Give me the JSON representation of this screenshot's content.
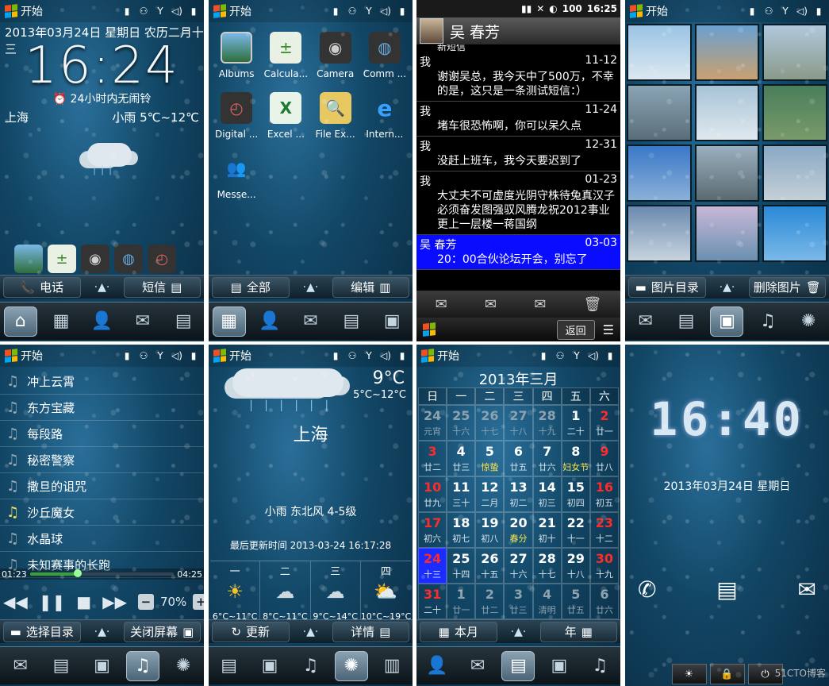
{
  "status": {
    "start_label": "开始"
  },
  "home": {
    "date": "2013年03月24日 星期日 农历二月十三",
    "time": "16:24",
    "alarm": "24小时内无闹铃",
    "city": "上海",
    "weather": "小雨 5℃~12℃",
    "soft_left": "电话",
    "soft_right": "短信"
  },
  "apps": {
    "items": [
      "Albums",
      "Calcula...",
      "Camera",
      "Comm ...",
      "Digital ...",
      "Excel ...",
      "File Ex...",
      "Intern...",
      "Messe..."
    ],
    "soft_left": "全部",
    "soft_right": "编辑"
  },
  "sms": {
    "contact": "吴 春芳",
    "time": "16:25",
    "battery": "100",
    "top_fragment": "新短信",
    "messages": [
      {
        "from": "我",
        "date": "11-12",
        "body": "谢谢吴总，我今天中了500万，不幸的是，这只是一条测试短信：）"
      },
      {
        "from": "我",
        "date": "11-24",
        "body": "堵车很恐怖啊，你可以呆久点"
      },
      {
        "from": "我",
        "date": "12-31",
        "body": "没赶上班车，我今天要迟到了"
      },
      {
        "from": "我",
        "date": "01-23",
        "body": "大丈夫不可虚度光阴守株待兔真汉子必须奋发图强驭风腾龙祝2012事业更上一层楼一蒋国纲"
      },
      {
        "from": "吴 春芳",
        "date": "03-03",
        "body": "20：00合伙论坛开会，别忘了"
      }
    ],
    "back": "返回"
  },
  "gallery": {
    "soft_left": "图片目录",
    "soft_right": "删除图片"
  },
  "music": {
    "songs": [
      "冲上云霄",
      "东方宝藏",
      "每段路",
      "秘密警察",
      "撒旦的诅咒",
      "沙丘魔女",
      "水晶球",
      "未知赛事的长跑"
    ],
    "current_index": 5,
    "elapsed": "01:23",
    "total": "04:25",
    "progress": 0.33,
    "volume": "70%",
    "soft_left": "选择目录",
    "soft_right": "关闭屏幕"
  },
  "weather": {
    "temp": "9°C",
    "range": "5°C~12°C",
    "city": "上海",
    "desc": "小雨 东北风 4-5级",
    "updated": "最后更新时间 2013-03-24 16:17:28",
    "forecast": [
      {
        "day": "一",
        "icon": "sun",
        "range": "6°C~11°C"
      },
      {
        "day": "二",
        "icon": "cloud-rain",
        "range": "8°C~11°C"
      },
      {
        "day": "三",
        "icon": "cloud-rain",
        "range": "9°C~14°C"
      },
      {
        "day": "四",
        "icon": "sun-cloud",
        "range": "10°C~19°C"
      }
    ],
    "soft_left": "更新",
    "soft_right": "详情"
  },
  "calendar": {
    "title": "2013年三月",
    "weekdays": [
      "日",
      "一",
      "二",
      "三",
      "四",
      "五",
      "六"
    ],
    "cells": [
      {
        "d": "24",
        "l": "元宵",
        "s": "dim"
      },
      {
        "d": "25",
        "l": "十六",
        "s": "dim"
      },
      {
        "d": "26",
        "l": "十七",
        "s": "dim"
      },
      {
        "d": "27",
        "l": "十八",
        "s": "dim"
      },
      {
        "d": "28",
        "l": "十九",
        "s": "dim"
      },
      {
        "d": "1",
        "l": "二十",
        "s": ""
      },
      {
        "d": "2",
        "l": "廿一",
        "s": "red"
      },
      {
        "d": "3",
        "l": "廿二",
        "s": "red"
      },
      {
        "d": "4",
        "l": "廿三",
        "s": ""
      },
      {
        "d": "5",
        "l": "惊蛰",
        "s": "fest"
      },
      {
        "d": "6",
        "l": "廿五",
        "s": ""
      },
      {
        "d": "7",
        "l": "廿六",
        "s": ""
      },
      {
        "d": "8",
        "l": "妇女节",
        "s": "fest"
      },
      {
        "d": "9",
        "l": "廿八",
        "s": "red"
      },
      {
        "d": "10",
        "l": "廿九",
        "s": "red"
      },
      {
        "d": "11",
        "l": "三十",
        "s": ""
      },
      {
        "d": "12",
        "l": "二月",
        "s": ""
      },
      {
        "d": "13",
        "l": "初二",
        "s": ""
      },
      {
        "d": "14",
        "l": "初三",
        "s": ""
      },
      {
        "d": "15",
        "l": "初四",
        "s": ""
      },
      {
        "d": "16",
        "l": "初五",
        "s": "red"
      },
      {
        "d": "17",
        "l": "初六",
        "s": "red"
      },
      {
        "d": "18",
        "l": "初七",
        "s": ""
      },
      {
        "d": "19",
        "l": "初八",
        "s": ""
      },
      {
        "d": "20",
        "l": "春分",
        "s": "fest"
      },
      {
        "d": "21",
        "l": "初十",
        "s": ""
      },
      {
        "d": "22",
        "l": "十一",
        "s": ""
      },
      {
        "d": "23",
        "l": "十二",
        "s": "red"
      },
      {
        "d": "24",
        "l": "十三",
        "s": "today"
      },
      {
        "d": "25",
        "l": "十四",
        "s": ""
      },
      {
        "d": "26",
        "l": "十五",
        "s": ""
      },
      {
        "d": "27",
        "l": "十六",
        "s": ""
      },
      {
        "d": "28",
        "l": "十七",
        "s": ""
      },
      {
        "d": "29",
        "l": "十八",
        "s": ""
      },
      {
        "d": "30",
        "l": "十九",
        "s": "red"
      },
      {
        "d": "31",
        "l": "二十",
        "s": "red"
      },
      {
        "d": "1",
        "l": "廿一",
        "s": "dim"
      },
      {
        "d": "2",
        "l": "廿二",
        "s": "dim"
      },
      {
        "d": "3",
        "l": "廿三",
        "s": "dim"
      },
      {
        "d": "4",
        "l": "清明",
        "s": "dim"
      },
      {
        "d": "5",
        "l": "廿五",
        "s": "dim"
      },
      {
        "d": "6",
        "l": "廿六",
        "s": "dim"
      }
    ],
    "soft_left": "本月",
    "soft_right": "年"
  },
  "lock": {
    "time": "16:40",
    "date": "2013年03月24日 星期日",
    "watermark": "51CTO博客"
  }
}
